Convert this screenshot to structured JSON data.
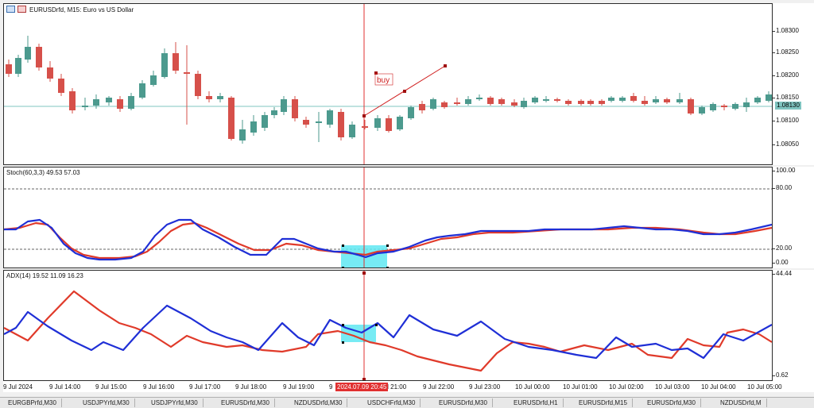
{
  "symbol_label": "EURUSDrfd, M15:  Euro vs US Dollar",
  "buy_label": "buy",
  "price_ticks": [
    "1.08300",
    "1.08250",
    "1.08200",
    "1.08150",
    "1.08100",
    "1.08050"
  ],
  "current_price": "1.08130",
  "stoch": {
    "label": "Stoch(60,3,3) 49.53 57.03",
    "ticks": [
      "100.00",
      "80.00",
      "20.00",
      "0.00"
    ]
  },
  "adx": {
    "label": "ADX(14) 19.52 11.09 16.23",
    "ticks": [
      "44.44",
      "0.62"
    ]
  },
  "time_labels": [
    "9 Jul 2024",
    "9 Jul 14:00",
    "9 Jul 15:00",
    "9 Jul 16:00",
    "9 Jul 17:00",
    "9 Jul 18:00",
    "9 Jul 19:00",
    "9",
    "9 Jul 21:00",
    "9 Jul 22:00",
    "9 Jul 23:00",
    "10 Jul 00:00",
    "10 Jul 01:00",
    "10 Jul 02:00",
    "10 Jul 03:00",
    "10 Jul 04:00",
    "10 Jul 05:00"
  ],
  "crosshair_time": "2024.07.09 20:45",
  "tabs": [
    "EURGBPrfd,M30",
    "USDJPYrfd,M30",
    "USDJPYrfd,M30",
    "EURUSDrfd,M30",
    "NZDUSDrfd,M30",
    "USDCHFrfd,M30",
    "EURUSDrfd,M30",
    "EURUSDrfd,H1",
    "EURUSDrfd,M15",
    "EURUSDrfd,M30",
    "NZDUSDrfd,M"
  ],
  "colors": {
    "bull": "#4c9a8e",
    "bear": "#d6504a",
    "blue": "#1f2fd6",
    "red": "#e03a2a",
    "highlight": "#5fe8f2",
    "price_line": "#7fc4c0"
  }
}
